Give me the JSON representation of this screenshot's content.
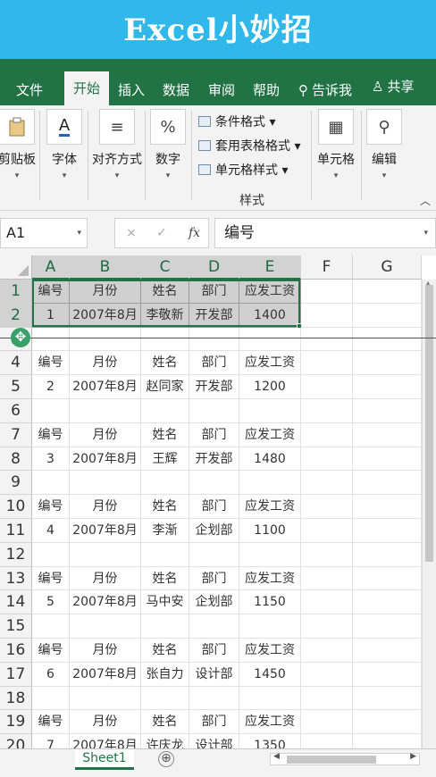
{
  "banner": {
    "title": "Excel小妙招"
  },
  "ribbon_tabs": [
    {
      "label": "文件",
      "active": false
    },
    {
      "label": "开始",
      "active": true
    },
    {
      "label": "插入",
      "active": false
    },
    {
      "label": "数据",
      "active": false
    },
    {
      "label": "审阅",
      "active": false
    },
    {
      "label": "帮助",
      "active": false
    },
    {
      "label": "告诉我",
      "active": false,
      "icon": "lightbulb-search-icon"
    },
    {
      "label": "共享",
      "active": false,
      "icon": "person-icon"
    }
  ],
  "ribbon": {
    "buttons": [
      {
        "label": "剪贴板",
        "icon": "clipboard-icon"
      },
      {
        "label": "字体",
        "icon": "font-color-icon"
      },
      {
        "label": "对齐方式",
        "icon": "align-icon"
      },
      {
        "label": "数字",
        "icon": "percent-icon"
      },
      {
        "label": "单元格",
        "icon": "cells-icon"
      },
      {
        "label": "编辑",
        "icon": "search-icon"
      }
    ],
    "styles_items": [
      {
        "label": "条件格式 ▾",
        "icon": "conditional-format-icon"
      },
      {
        "label": "套用表格格式 ▾",
        "icon": "table-format-icon"
      },
      {
        "label": "单元格样式 ▾",
        "icon": "cell-style-icon"
      }
    ],
    "styles_group_label": "样式"
  },
  "formula_bar": {
    "name_box": "A1",
    "cancel": "×",
    "confirm": "✓",
    "fx": "fx",
    "content": "编号"
  },
  "columns": [
    "A",
    "B",
    "C",
    "D",
    "E",
    "F",
    "G"
  ],
  "rows": [
    "1",
    "2",
    "3",
    "4",
    "5",
    "6",
    "7",
    "8",
    "9",
    "10",
    "11",
    "12",
    "13",
    "14",
    "15",
    "16",
    "17",
    "18",
    "19",
    "20"
  ],
  "grid": {
    "selected_range": "A1:E2",
    "row_values": [
      [
        "编号",
        "月份",
        "姓名",
        "部门",
        "应发工资"
      ],
      [
        "1",
        "2007年8月",
        "李敬新",
        "开发部",
        "1400"
      ],
      [
        "",
        "",
        "",
        "",
        ""
      ],
      [
        "编号",
        "月份",
        "姓名",
        "部门",
        "应发工资"
      ],
      [
        "2",
        "2007年8月",
        "赵同家",
        "开发部",
        "1200"
      ],
      [
        "",
        "",
        "",
        "",
        ""
      ],
      [
        "编号",
        "月份",
        "姓名",
        "部门",
        "应发工资"
      ],
      [
        "3",
        "2007年8月",
        "王辉",
        "开发部",
        "1480"
      ],
      [
        "",
        "",
        "",
        "",
        ""
      ],
      [
        "编号",
        "月份",
        "姓名",
        "部门",
        "应发工资"
      ],
      [
        "4",
        "2007年8月",
        "李渐",
        "企划部",
        "1100"
      ],
      [
        "",
        "",
        "",
        "",
        ""
      ],
      [
        "编号",
        "月份",
        "姓名",
        "部门",
        "应发工资"
      ],
      [
        "5",
        "2007年8月",
        "马中安",
        "企划部",
        "1150"
      ],
      [
        "",
        "",
        "",
        "",
        ""
      ],
      [
        "编号",
        "月份",
        "姓名",
        "部门",
        "应发工资"
      ],
      [
        "6",
        "2007年8月",
        "张自力",
        "设计部",
        "1450"
      ],
      [
        "",
        "",
        "",
        "",
        ""
      ],
      [
        "编号",
        "月份",
        "姓名",
        "部门",
        "应发工资"
      ],
      [
        "7",
        "2007年8月",
        "许庆龙",
        "设计部",
        "1350"
      ]
    ]
  },
  "sheets": [
    {
      "label": "Sheet1",
      "active": true
    }
  ],
  "add_sheet": "⊕"
}
